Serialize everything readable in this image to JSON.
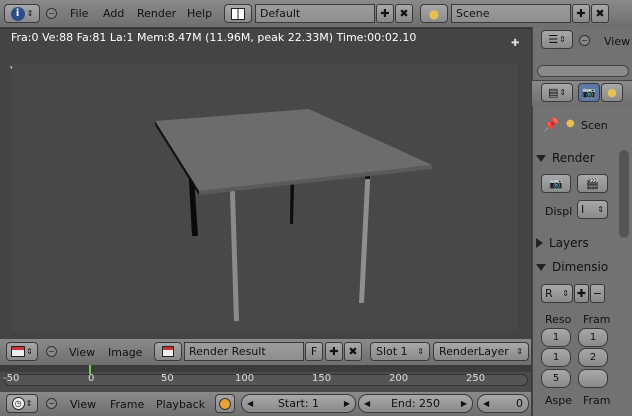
{
  "top_bar": {
    "menus": [
      "File",
      "Add",
      "Render",
      "Help"
    ],
    "screen_layout": "Default",
    "scene": "Scene"
  },
  "viewport": {
    "stats": "Fra:0  Ve:88 Fa:81 La:1 Mem:8.47M (11.96M, peak 22.33M) Time:00:02.10"
  },
  "image_editor_header": {
    "menus": [
      "View",
      "Image"
    ],
    "image_name": "Render Result",
    "fake_user": "F",
    "slot": "Slot 1",
    "layer": "RenderLayer"
  },
  "timeline": {
    "ticks": [
      "-50",
      "0",
      "50",
      "100",
      "150",
      "200",
      "250"
    ],
    "current_frame_marker": 0
  },
  "timeline_header": {
    "menus": [
      "View",
      "Frame",
      "Playback"
    ],
    "start_label": "Start: 1",
    "end_label": "End: 250",
    "current_frame": "0"
  },
  "properties": {
    "top_view_label": "View",
    "context_scene": "Scen",
    "render_panel": "Render",
    "display_label": "Displ",
    "display_value": "I",
    "layers_panel": "Layers",
    "dimensions_panel": "Dimensio",
    "preset_value": "R",
    "resolution_label": "Reso",
    "frames_label": "Fram",
    "res_x": "1",
    "res_y": "1",
    "res_pct": "5",
    "frame_a": "1",
    "frame_b": "2",
    "aspect_label": "Aspe",
    "frame_rate_label": "Fram"
  },
  "colors": {
    "header": "#727272",
    "viewport_bg": "#444444",
    "render_bg": "#484848",
    "timeline_bg": "#4b4b4b",
    "frame_marker": "#6ad04a"
  }
}
